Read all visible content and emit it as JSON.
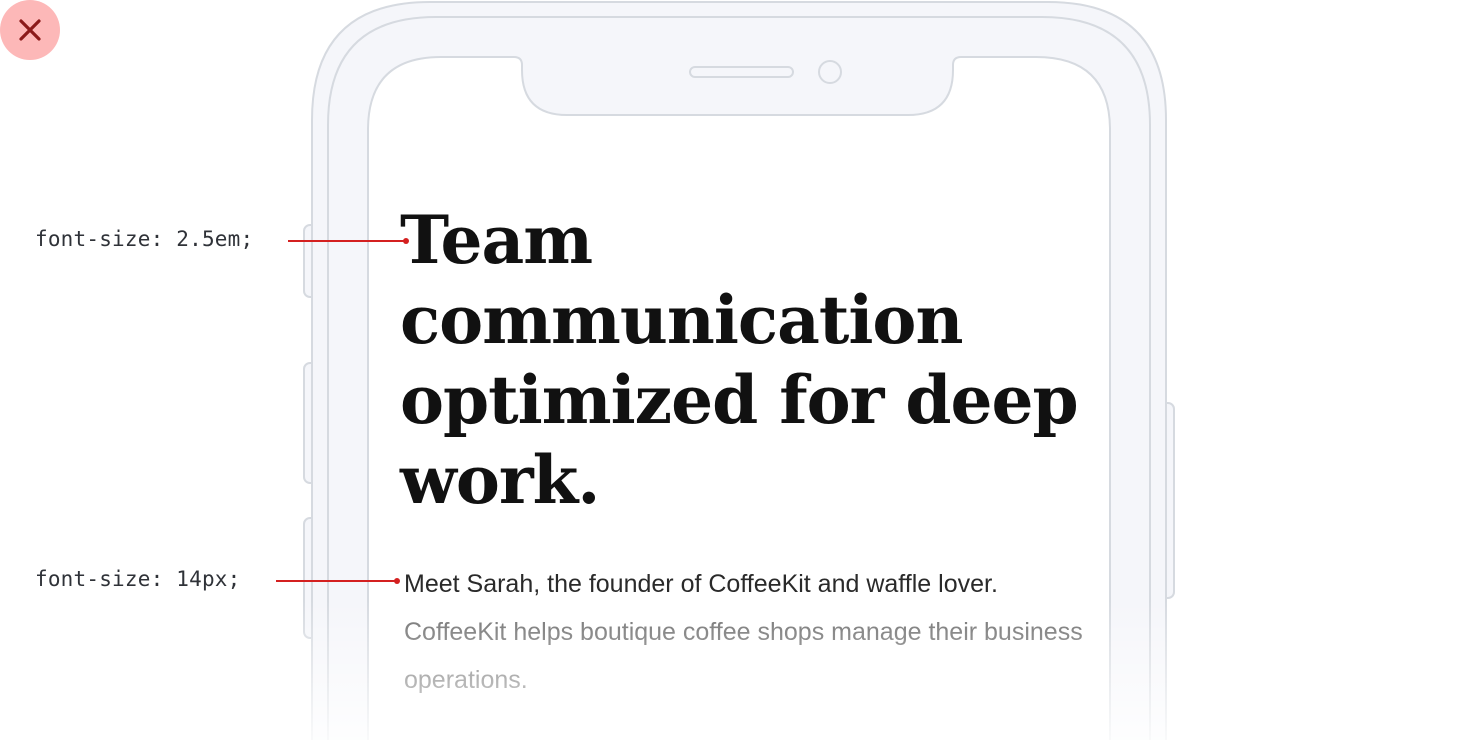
{
  "close_button": {
    "icon": "close-icon",
    "color": "#8b1a1a",
    "background": "#fdb8b8"
  },
  "annotations": {
    "heading_size": "font-size: 2.5em;",
    "body_size": "font-size: 14px;",
    "line_color": "#d42020"
  },
  "content": {
    "headline": "Team communication optimized for deep work.",
    "body_line1": "Meet Sarah, the founder of CoffeeKit and waffle lover.",
    "body_rest": "CoffeeKit helps boutique coffee shops manage their business operations."
  },
  "phone": {
    "frame_color": "#d6dae0",
    "bezel_fill": "#f5f6fa"
  }
}
